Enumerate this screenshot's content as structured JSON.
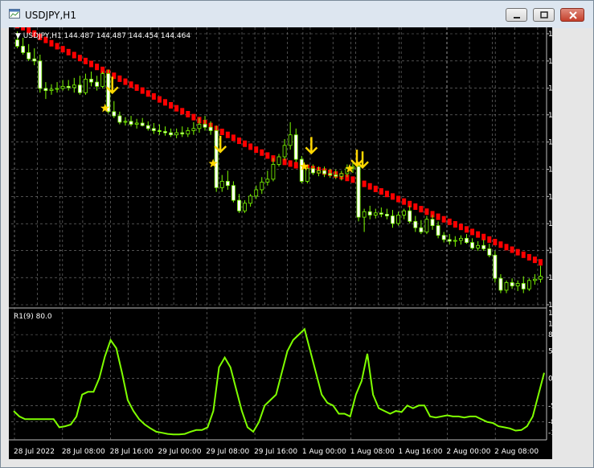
{
  "window": {
    "title": "USDJPY,H1"
  },
  "main_info": {
    "symbol": "USDJPY,H1",
    "ohlc": "144.487 144.487 144.454 144.464"
  },
  "rsi_label": "R1(9) 80.0",
  "colors": {
    "bull": "#ffffff",
    "bear": "#ffffff",
    "ribbon": "#ff0000",
    "signal": "#ffd700",
    "dots": "#7cfc00",
    "rsi": "#7fff00",
    "grid": "#808080"
  },
  "chart_data": [
    {
      "type": "candlestick",
      "title": "USDJPY,H1",
      "y_ticks": [
        "136.695",
        "136.050",
        "135.405",
        "134.775",
        "134.130",
        "133.485",
        "132.840",
        "132.195",
        "131.565",
        "130.920",
        "130.275"
      ],
      "ylim": [
        130.275,
        136.695
      ],
      "x_ticks": [
        "28 Jul 2022",
        "28 Jul 08:00",
        "28 Jul 16:00",
        "29 Jul 00:00",
        "29 Jul 08:00",
        "29 Jul 16:00",
        "1 Aug 00:00",
        "1 Aug 08:00",
        "1 Aug 16:00",
        "2 Aug 00:00",
        "2 Aug 08:00"
      ],
      "candles": [
        {
          "o": 136.55,
          "h": 136.75,
          "l": 136.35,
          "c": 136.4
        },
        {
          "o": 136.4,
          "h": 136.6,
          "l": 136.2,
          "c": 136.25
        },
        {
          "o": 136.25,
          "h": 136.45,
          "l": 136.05,
          "c": 136.1
        },
        {
          "o": 136.1,
          "h": 136.35,
          "l": 135.95,
          "c": 136.05
        },
        {
          "o": 136.05,
          "h": 136.2,
          "l": 135.3,
          "c": 135.4
        },
        {
          "o": 135.4,
          "h": 135.55,
          "l": 135.15,
          "c": 135.35
        },
        {
          "o": 135.35,
          "h": 135.5,
          "l": 135.25,
          "c": 135.38
        },
        {
          "o": 135.38,
          "h": 135.55,
          "l": 135.3,
          "c": 135.4
        },
        {
          "o": 135.4,
          "h": 135.6,
          "l": 135.35,
          "c": 135.45
        },
        {
          "o": 135.45,
          "h": 135.6,
          "l": 135.35,
          "c": 135.42
        },
        {
          "o": 135.42,
          "h": 135.65,
          "l": 135.3,
          "c": 135.48
        },
        {
          "o": 135.48,
          "h": 135.7,
          "l": 135.25,
          "c": 135.3
        },
        {
          "o": 135.3,
          "h": 135.75,
          "l": 135.25,
          "c": 135.62
        },
        {
          "o": 135.62,
          "h": 135.8,
          "l": 135.45,
          "c": 135.55
        },
        {
          "o": 135.55,
          "h": 135.7,
          "l": 135.35,
          "c": 135.45
        },
        {
          "o": 135.45,
          "h": 135.8,
          "l": 135.4,
          "c": 135.75
        },
        {
          "o": 135.75,
          "h": 135.85,
          "l": 134.8,
          "c": 134.85
        },
        {
          "o": 134.85,
          "h": 135.1,
          "l": 134.7,
          "c": 134.75
        },
        {
          "o": 134.75,
          "h": 134.85,
          "l": 134.55,
          "c": 134.6
        },
        {
          "o": 134.6,
          "h": 134.72,
          "l": 134.52,
          "c": 134.62
        },
        {
          "o": 134.62,
          "h": 134.75,
          "l": 134.5,
          "c": 134.55
        },
        {
          "o": 134.55,
          "h": 134.68,
          "l": 134.45,
          "c": 134.58
        },
        {
          "o": 134.58,
          "h": 134.7,
          "l": 134.5,
          "c": 134.52
        },
        {
          "o": 134.52,
          "h": 134.62,
          "l": 134.4,
          "c": 134.45
        },
        {
          "o": 134.45,
          "h": 134.58,
          "l": 134.32,
          "c": 134.4
        },
        {
          "o": 134.4,
          "h": 134.55,
          "l": 134.3,
          "c": 134.38
        },
        {
          "o": 134.38,
          "h": 134.5,
          "l": 134.28,
          "c": 134.35
        },
        {
          "o": 134.35,
          "h": 134.45,
          "l": 134.25,
          "c": 134.3
        },
        {
          "o": 134.3,
          "h": 134.45,
          "l": 134.22,
          "c": 134.35
        },
        {
          "o": 134.35,
          "h": 134.5,
          "l": 134.25,
          "c": 134.32
        },
        {
          "o": 134.32,
          "h": 134.48,
          "l": 134.25,
          "c": 134.4
        },
        {
          "o": 134.4,
          "h": 134.6,
          "l": 134.3,
          "c": 134.45
        },
        {
          "o": 134.45,
          "h": 134.7,
          "l": 134.35,
          "c": 134.55
        },
        {
          "o": 134.55,
          "h": 134.75,
          "l": 134.4,
          "c": 134.48
        },
        {
          "o": 134.48,
          "h": 134.62,
          "l": 134.3,
          "c": 134.4
        },
        {
          "o": 134.4,
          "h": 134.52,
          "l": 132.95,
          "c": 133.05
        },
        {
          "o": 133.05,
          "h": 133.35,
          "l": 132.95,
          "c": 133.2
        },
        {
          "o": 133.2,
          "h": 133.45,
          "l": 133.0,
          "c": 133.1
        },
        {
          "o": 133.1,
          "h": 133.2,
          "l": 132.7,
          "c": 132.75
        },
        {
          "o": 132.75,
          "h": 132.9,
          "l": 132.45,
          "c": 132.5
        },
        {
          "o": 132.5,
          "h": 132.75,
          "l": 132.45,
          "c": 132.68
        },
        {
          "o": 132.68,
          "h": 132.9,
          "l": 132.6,
          "c": 132.85
        },
        {
          "o": 132.85,
          "h": 133.1,
          "l": 132.78,
          "c": 133.0
        },
        {
          "o": 133.0,
          "h": 133.3,
          "l": 132.9,
          "c": 133.18
        },
        {
          "o": 133.18,
          "h": 133.45,
          "l": 133.1,
          "c": 133.25
        },
        {
          "o": 133.25,
          "h": 133.75,
          "l": 133.2,
          "c": 133.6
        },
        {
          "o": 133.6,
          "h": 133.85,
          "l": 133.55,
          "c": 133.78
        },
        {
          "o": 133.78,
          "h": 134.2,
          "l": 133.7,
          "c": 134.05
        },
        {
          "o": 134.05,
          "h": 134.6,
          "l": 133.95,
          "c": 134.3
        },
        {
          "o": 134.3,
          "h": 134.45,
          "l": 133.65,
          "c": 133.72
        },
        {
          "o": 133.72,
          "h": 133.8,
          "l": 133.15,
          "c": 133.2
        },
        {
          "o": 133.2,
          "h": 133.6,
          "l": 133.15,
          "c": 133.5
        },
        {
          "o": 133.5,
          "h": 133.6,
          "l": 133.35,
          "c": 133.4
        },
        {
          "o": 133.4,
          "h": 133.55,
          "l": 133.32,
          "c": 133.45
        },
        {
          "o": 133.45,
          "h": 133.55,
          "l": 133.3,
          "c": 133.38
        },
        {
          "o": 133.38,
          "h": 133.5,
          "l": 133.28,
          "c": 133.35
        },
        {
          "o": 133.35,
          "h": 133.48,
          "l": 133.25,
          "c": 133.32
        },
        {
          "o": 133.32,
          "h": 133.45,
          "l": 133.22,
          "c": 133.38
        },
        {
          "o": 133.38,
          "h": 133.6,
          "l": 133.3,
          "c": 133.5
        },
        {
          "o": 133.5,
          "h": 133.65,
          "l": 133.4,
          "c": 133.55
        },
        {
          "o": 133.55,
          "h": 133.62,
          "l": 132.25,
          "c": 132.35
        },
        {
          "o": 132.35,
          "h": 132.55,
          "l": 132.0,
          "c": 132.48
        },
        {
          "o": 132.48,
          "h": 132.62,
          "l": 132.3,
          "c": 132.4
        },
        {
          "o": 132.4,
          "h": 132.55,
          "l": 132.32,
          "c": 132.45
        },
        {
          "o": 132.45,
          "h": 132.58,
          "l": 132.35,
          "c": 132.42
        },
        {
          "o": 132.42,
          "h": 132.55,
          "l": 132.3,
          "c": 132.38
        },
        {
          "o": 132.38,
          "h": 132.52,
          "l": 132.1,
          "c": 132.2
        },
        {
          "o": 132.2,
          "h": 132.48,
          "l": 132.15,
          "c": 132.4
        },
        {
          "o": 132.4,
          "h": 132.55,
          "l": 132.3,
          "c": 132.5
        },
        {
          "o": 132.5,
          "h": 132.62,
          "l": 132.2,
          "c": 132.25
        },
        {
          "o": 132.25,
          "h": 132.38,
          "l": 132.0,
          "c": 132.1
        },
        {
          "o": 132.1,
          "h": 132.28,
          "l": 131.95,
          "c": 132.0
        },
        {
          "o": 132.0,
          "h": 132.38,
          "l": 131.95,
          "c": 132.3
        },
        {
          "o": 132.3,
          "h": 132.4,
          "l": 132.05,
          "c": 132.15
        },
        {
          "o": 132.15,
          "h": 132.25,
          "l": 131.85,
          "c": 131.92
        },
        {
          "o": 131.92,
          "h": 132.0,
          "l": 131.75,
          "c": 131.82
        },
        {
          "o": 131.82,
          "h": 131.95,
          "l": 131.7,
          "c": 131.78
        },
        {
          "o": 131.78,
          "h": 131.9,
          "l": 131.65,
          "c": 131.8
        },
        {
          "o": 131.8,
          "h": 131.92,
          "l": 131.7,
          "c": 131.85
        },
        {
          "o": 131.85,
          "h": 131.95,
          "l": 131.72,
          "c": 131.75
        },
        {
          "o": 131.75,
          "h": 131.85,
          "l": 131.58,
          "c": 131.62
        },
        {
          "o": 131.62,
          "h": 131.78,
          "l": 131.55,
          "c": 131.68
        },
        {
          "o": 131.68,
          "h": 131.82,
          "l": 131.55,
          "c": 131.6
        },
        {
          "o": 131.6,
          "h": 131.72,
          "l": 131.4,
          "c": 131.45
        },
        {
          "o": 131.45,
          "h": 131.55,
          "l": 130.8,
          "c": 130.9
        },
        {
          "o": 130.9,
          "h": 131.0,
          "l": 130.55,
          "c": 130.62
        },
        {
          "o": 130.62,
          "h": 130.85,
          "l": 130.55,
          "c": 130.8
        },
        {
          "o": 130.8,
          "h": 130.9,
          "l": 130.65,
          "c": 130.72
        },
        {
          "o": 130.72,
          "h": 130.85,
          "l": 130.6,
          "c": 130.78
        },
        {
          "o": 130.78,
          "h": 130.95,
          "l": 130.55,
          "c": 130.65
        },
        {
          "o": 130.65,
          "h": 130.9,
          "l": 130.6,
          "c": 130.85
        },
        {
          "o": 130.85,
          "h": 131.0,
          "l": 130.75,
          "c": 130.88
        },
        {
          "o": 130.88,
          "h": 131.2,
          "l": 130.8,
          "c": 130.95
        }
      ],
      "ribbon": [
        136.9,
        136.85,
        136.78,
        136.7,
        136.62,
        136.55,
        136.47,
        136.4,
        136.33,
        136.26,
        136.19,
        136.12,
        136.05,
        135.98,
        135.91,
        135.84,
        135.77,
        135.7,
        135.63,
        135.56,
        135.49,
        135.42,
        135.35,
        135.28,
        135.21,
        135.14,
        135.07,
        135.0,
        134.93,
        134.86,
        134.79,
        134.72,
        134.65,
        134.58,
        134.51,
        134.44,
        134.37,
        134.3,
        134.23,
        134.16,
        134.09,
        134.02,
        133.95,
        133.88,
        133.81,
        133.74,
        133.7,
        133.66,
        133.62,
        133.58,
        133.55,
        133.52,
        133.49,
        133.46,
        133.43,
        133.4,
        133.36,
        133.32,
        133.28,
        133.24,
        133.2,
        133.14,
        133.08,
        133.02,
        132.96,
        132.9,
        132.84,
        132.78,
        132.72,
        132.66,
        132.6,
        132.54,
        132.48,
        132.42,
        132.36,
        132.3,
        132.24,
        132.18,
        132.12,
        132.06,
        132.0,
        131.94,
        131.88,
        131.82,
        131.76,
        131.7,
        131.64,
        131.58,
        131.52,
        131.46,
        131.4,
        131.34,
        131.28,
        131.22
      ],
      "signals": [
        {
          "index": 16,
          "arrow": 135.45,
          "star": 134.93
        },
        {
          "index": 35,
          "arrow": 134.05,
          "star": 133.62
        },
        {
          "index": 51,
          "arrow": 134.02,
          "star": 133.55
        },
        {
          "index": 59,
          "arrow": 133.72,
          "star": 133.5
        },
        {
          "index": 60,
          "arrow": 133.68,
          "star": null
        }
      ]
    },
    {
      "type": "line",
      "title": "R1(9) 80.0",
      "y_ticks": [
        "120",
        "100",
        "80",
        "50",
        "0.00",
        "-50",
        "-80",
        "-100"
      ],
      "ylim": [
        -110,
        120
      ],
      "values": [
        -60,
        -70,
        -75,
        -75,
        -75,
        -75,
        -75,
        -75,
        -90,
        -88,
        -85,
        -70,
        -30,
        -25,
        -25,
        0,
        40,
        70,
        55,
        10,
        -40,
        -60,
        -75,
        -85,
        -92,
        -98,
        -100,
        -102,
        -103,
        -103,
        -102,
        -98,
        -95,
        -95,
        -90,
        -60,
        20,
        38,
        20,
        -20,
        -60,
        -90,
        -98,
        -80,
        -50,
        -40,
        -30,
        10,
        50,
        70,
        80,
        90,
        50,
        10,
        -30,
        -45,
        -50,
        -65,
        -65,
        -70,
        -30,
        -5,
        45,
        -30,
        -55,
        -60,
        -65,
        -60,
        -62,
        -50,
        -55,
        -50,
        -50,
        -70,
        -72,
        -70,
        -68,
        -70,
        -70,
        -72,
        -70,
        -70,
        -75,
        -80,
        -82,
        -88,
        -90,
        -92,
        -96,
        -95,
        -88,
        -70,
        -30,
        10
      ]
    }
  ]
}
